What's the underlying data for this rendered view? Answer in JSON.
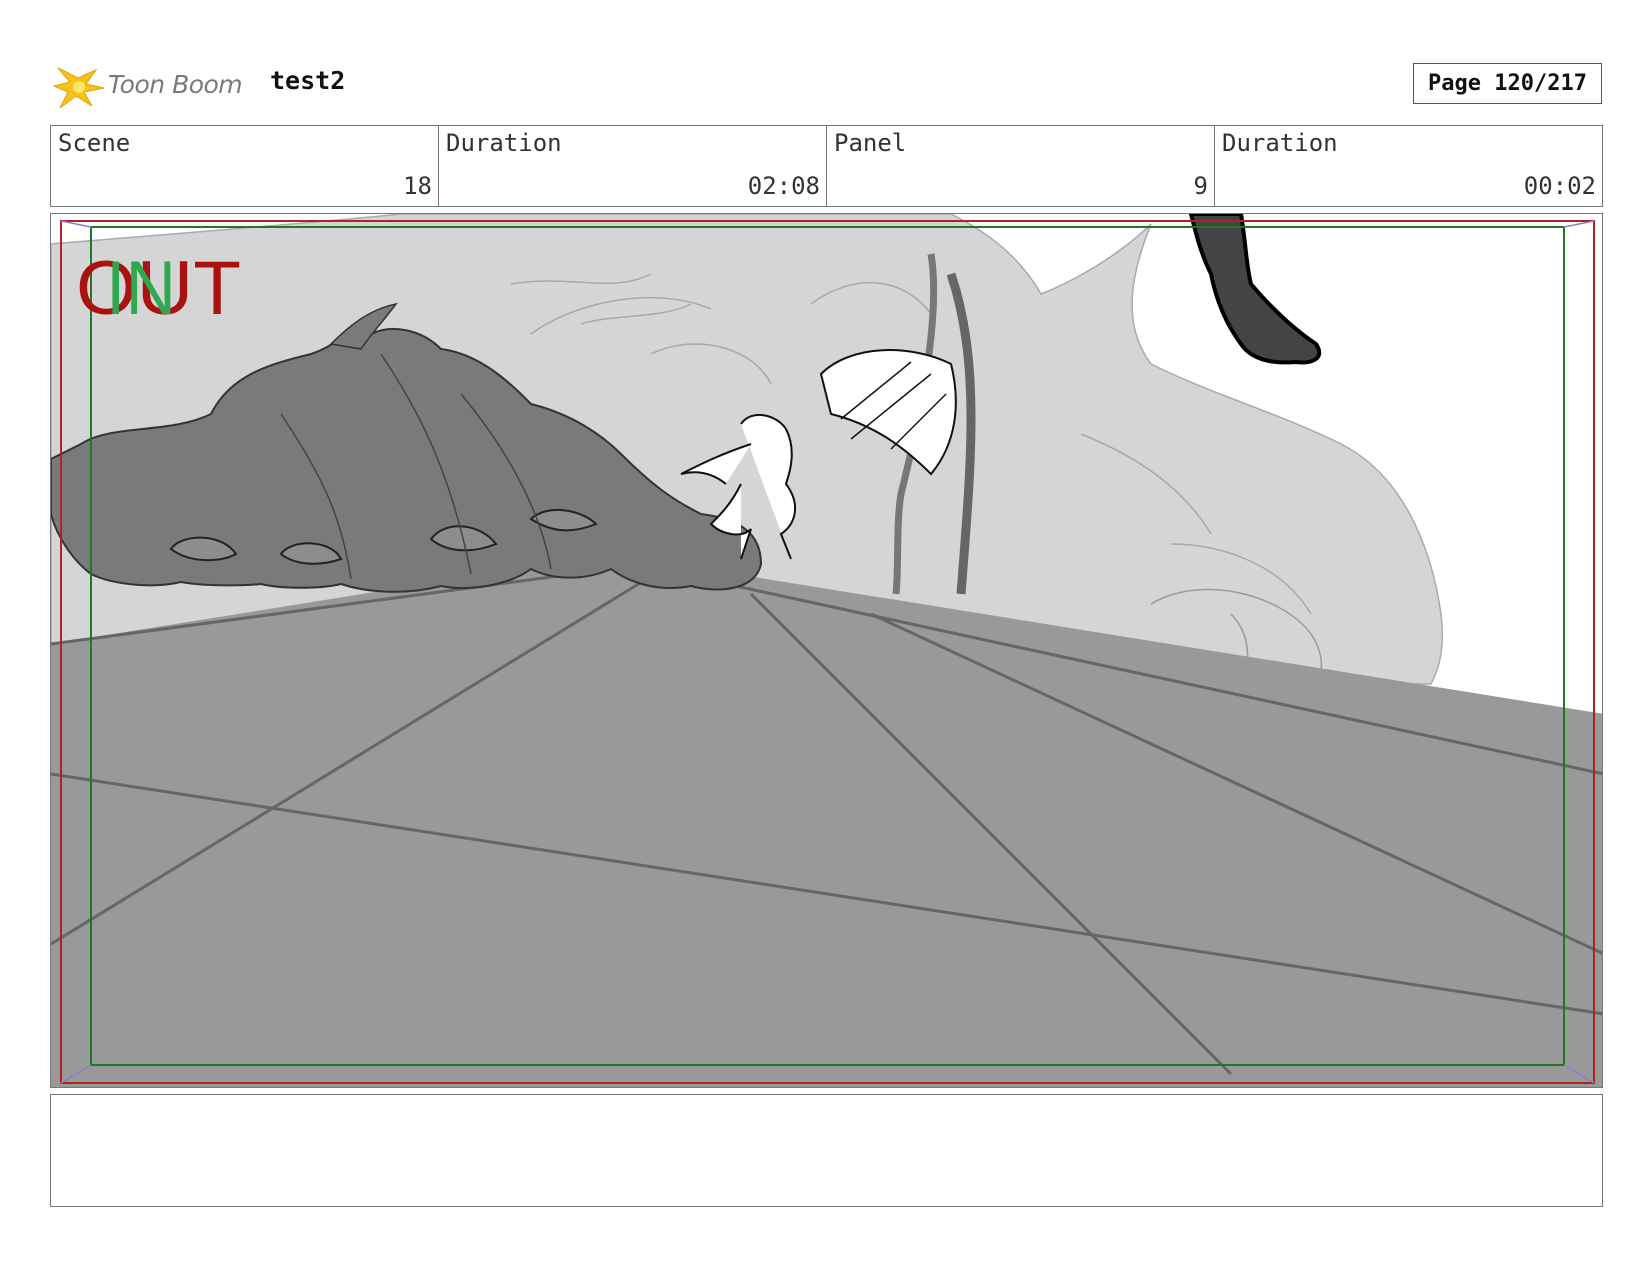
{
  "header": {
    "logo_text": "Toon Boom",
    "project_title": "test2",
    "page_label": "Page 120/217"
  },
  "info": {
    "scene_label": "Scene",
    "scene_value": "18",
    "scene_duration_label": "Duration",
    "scene_duration_value": "02:08",
    "panel_label": "Panel",
    "panel_value": "9",
    "panel_duration_label": "Duration",
    "panel_duration_value": "00:02"
  },
  "panel": {
    "in_label": "IN",
    "out_label": "OUT",
    "colors": {
      "in_marker": "#2fa84f",
      "out_marker": "#aa1111",
      "safe_frame": "#1f7a1f",
      "camera_frame": "#b22222"
    }
  },
  "notes": {
    "text": ""
  }
}
